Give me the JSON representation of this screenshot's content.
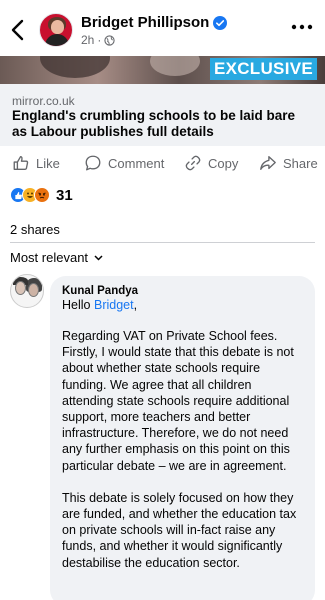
{
  "header": {
    "author": "Bridget Phillipson",
    "time": "2h",
    "privacy_icon": "globe-icon"
  },
  "post": {
    "image_badge": "EXCLUSIVE",
    "link_domain": "mirror.co.uk",
    "link_title": "England's crumbling schools to be laid bare as Labour publishes full details"
  },
  "actions": {
    "like": "Like",
    "comment": "Comment",
    "copy": "Copy",
    "share": "Share"
  },
  "stats": {
    "reaction_count": "31",
    "shares": "2 shares"
  },
  "comments": {
    "sort_label": "Most relevant",
    "items": [
      {
        "name": "Kunal Pandya",
        "greeting_prefix": "Hello",
        "mention": "Bridget",
        "greeting_suffix": ",",
        "paragraphs": [
          "Regarding VAT on Private School fees. Firstly, I would state that this debate is not about whether state schools require funding. We agree that all children attending state schools require additional support, more teachers and better infrastructure. Therefore, we do not need any further emphasis on this point on this particular debate – we are in agreement.",
          "This debate is solely focused on how they are funded, and whether the education tax on private schools will in-fact raise any funds, and whether it would significantly destabilise the education sector."
        ]
      }
    ]
  },
  "colors": {
    "accent": "#1877f2",
    "badge": "#29a9e1",
    "secondary_text": "#65676b",
    "bubble_bg": "#f0f2f5"
  }
}
